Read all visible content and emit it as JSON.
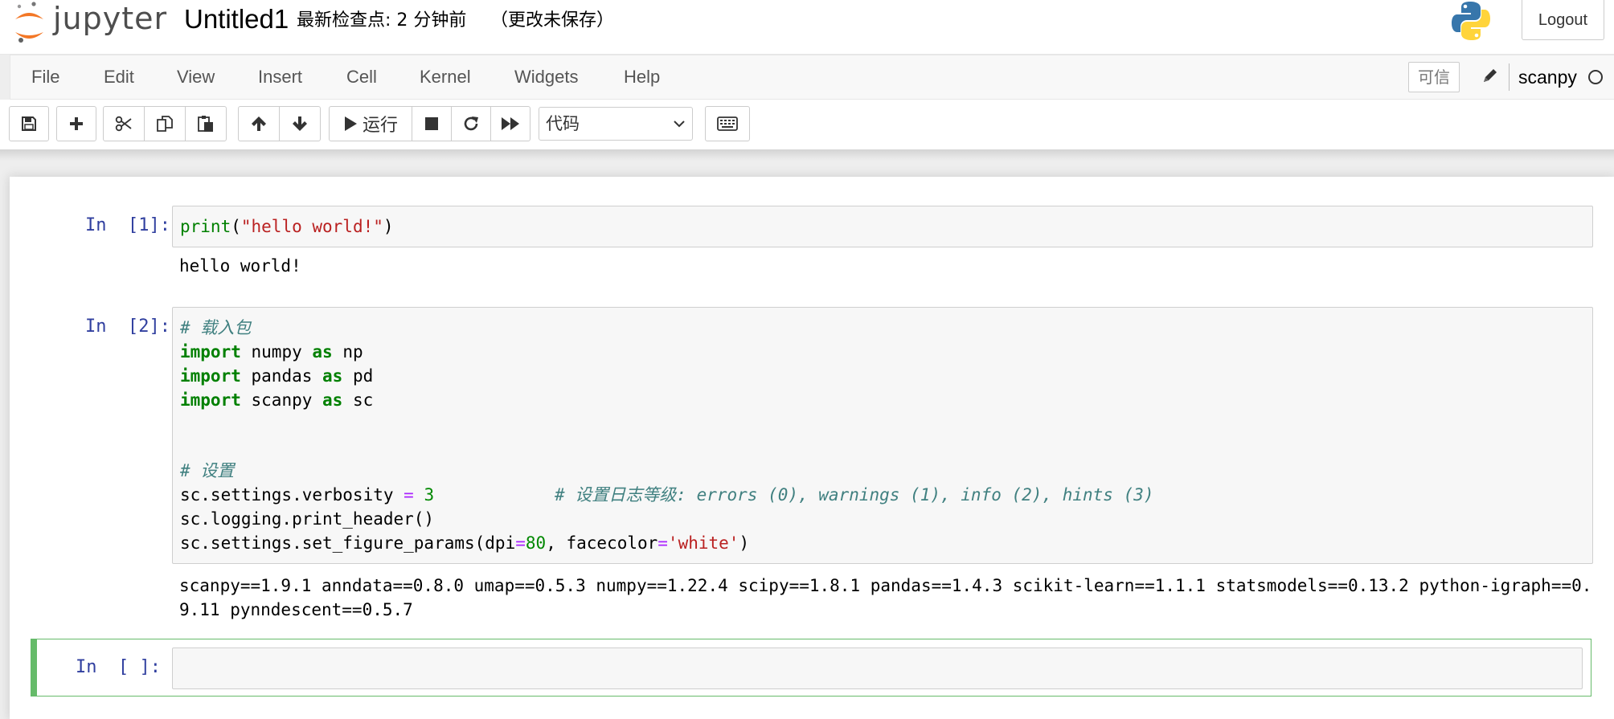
{
  "header": {
    "logo_text": "jupyter",
    "notebook_name": "Untitled1",
    "checkpoint": "最新检查点: 2 分钟前",
    "autosave_status": "（更改未保存）",
    "logout_label": "Logout"
  },
  "menubar": {
    "items": [
      "File",
      "Edit",
      "View",
      "Insert",
      "Cell",
      "Kernel",
      "Widgets",
      "Help"
    ],
    "trusted_label": "可信",
    "kernel_name": "scanpy"
  },
  "toolbar": {
    "run_label": "运行",
    "cell_type": "代码"
  },
  "cells": [
    {
      "prompt": "In  [1]:",
      "output": "hello world!"
    },
    {
      "prompt": "In  [2]:",
      "code_comment_1": "# 载入包",
      "code_lib_1": "numpy",
      "code_alias_1": "np",
      "code_lib_2": "pandas",
      "code_alias_2": "pd",
      "code_lib_3": "scanpy",
      "code_alias_3": "sc",
      "code_comment_2": "# 设置",
      "code_comment_3": "# 设置日志等级: errors (0), warnings (1), info (2), hints (3)",
      "output_line_1": "scanpy==1.9.1 anndata==0.8.0 umap==0.5.3 numpy==1.22.4 scipy==1.8.1 pandas==1.4.3 scikit-learn==1.1.1 statsmodels==0.13.2 python-igraph==0.",
      "output_line_2": "9.11 pynndescent==0.5.7"
    },
    {
      "prompt": "In  [ ]:"
    }
  ],
  "icons": [
    "jupyter-logo-icon",
    "python-logo-icon",
    "pencil-icon",
    "kernel-idle-icon",
    "save-icon",
    "plus-icon",
    "scissors-icon",
    "copy-icon",
    "paste-icon",
    "arrow-up-icon",
    "arrow-down-icon",
    "play-icon",
    "stop-icon",
    "restart-icon",
    "fast-forward-icon",
    "chevron-down-icon",
    "keyboard-icon"
  ]
}
